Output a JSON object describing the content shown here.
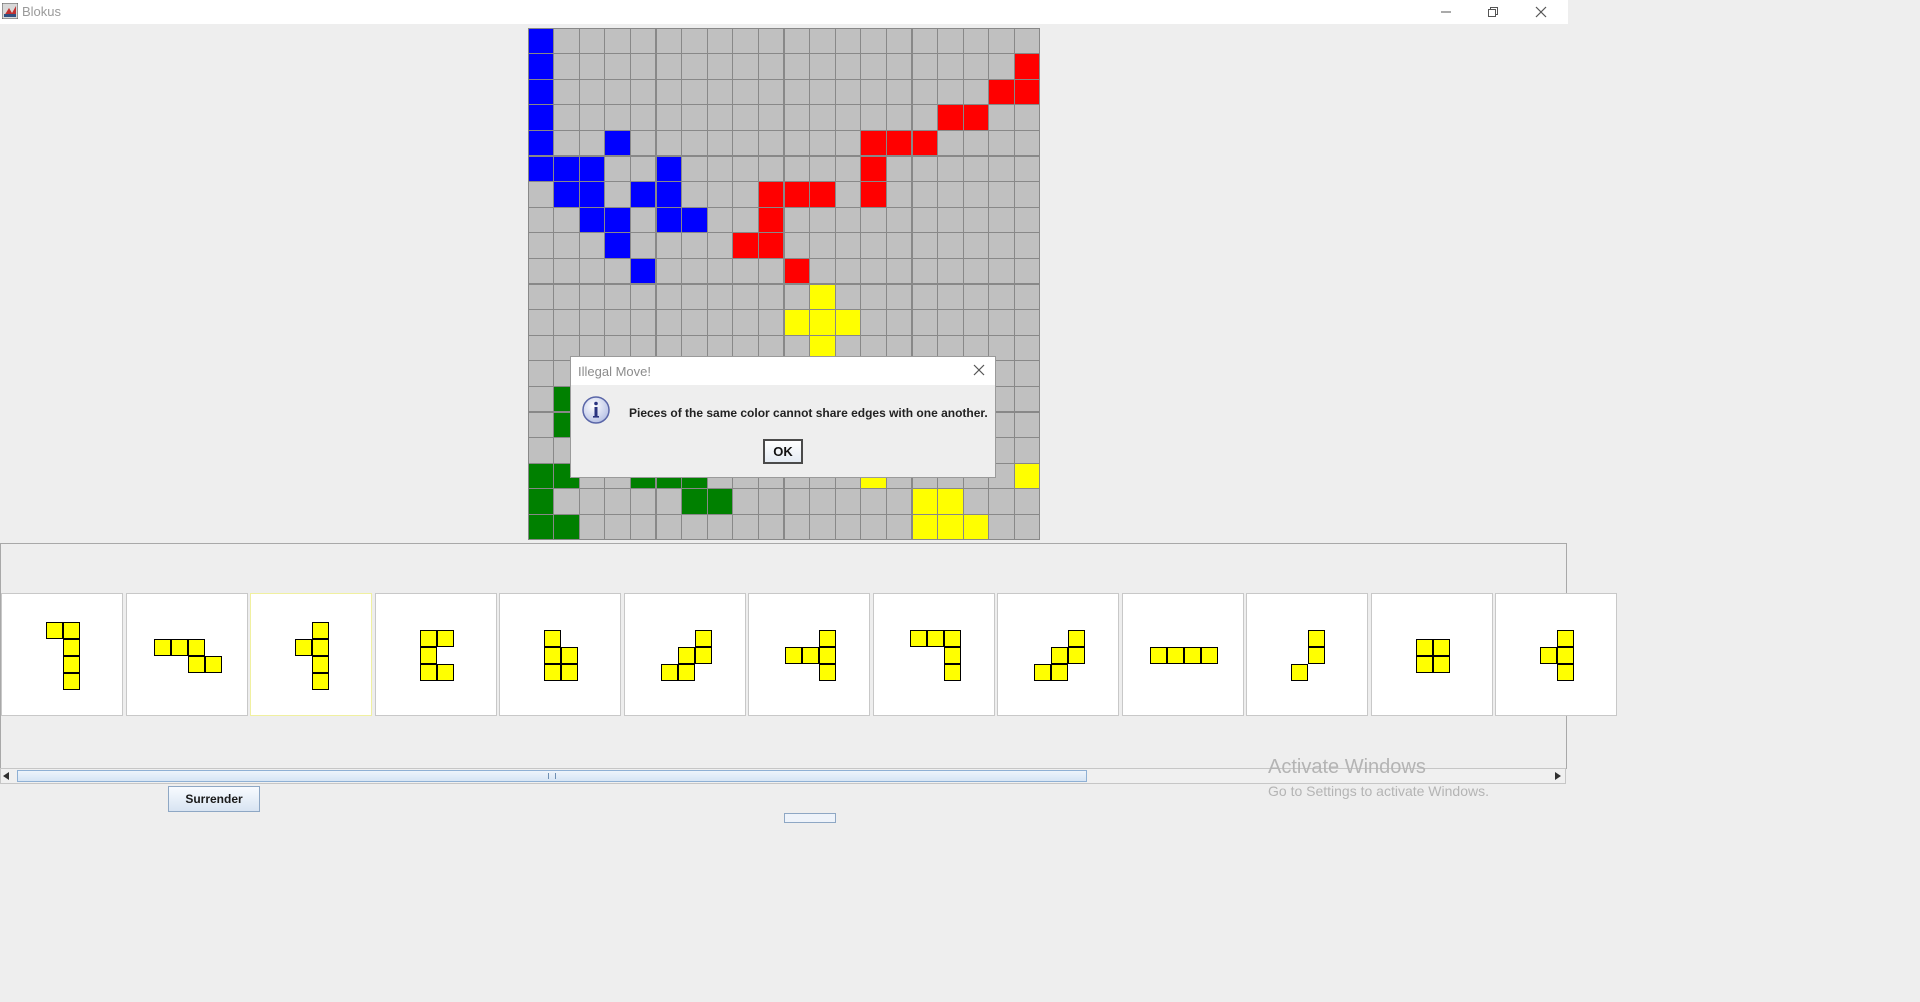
{
  "window": {
    "title": "Blokus",
    "icons": [
      "app-icon",
      "minimize-icon",
      "restore-icon",
      "close-icon"
    ]
  },
  "colors": {
    "B": "#0000ff",
    "R": "#ff0000",
    "Y": "#ffff00",
    "G": "#008000",
    "empty": "#c0c0c0",
    "grid": "#888888"
  },
  "board": {
    "size": 20,
    "rows": [
      "B...................",
      "B..................R",
      "B.................RR",
      "B...............RR..",
      "B..B.........RRR....",
      "BBB..B.......R......",
      ".BB.BB...RRR.R......",
      "..BB.BB..R..........",
      "...B....RR..........",
      "....B.....R........",
      "...........Y........",
      "..........YYY.......",
      "...........Y........",
      "............Y.......",
      ".G..................",
      ".G..................",
      "....................",
      "GG..GGG......Y.....Y",
      "G.....GG.......YY...",
      "GG.............YYY.."
    ]
  },
  "piece_tray": {
    "selected_index": 2,
    "pieces": [
      [
        [
          0,
          0
        ],
        [
          1,
          0
        ],
        [
          1,
          1
        ],
        [
          1,
          2
        ],
        [
          1,
          3
        ]
      ],
      [
        [
          0,
          0
        ],
        [
          1,
          0
        ],
        [
          2,
          0
        ],
        [
          2,
          1
        ],
        [
          3,
          1
        ]
      ],
      [
        [
          1,
          0
        ],
        [
          0,
          1
        ],
        [
          1,
          1
        ],
        [
          1,
          2
        ],
        [
          1,
          3
        ]
      ],
      [
        [
          0,
          0
        ],
        [
          1,
          0
        ],
        [
          0,
          1
        ],
        [
          0,
          2
        ],
        [
          1,
          2
        ]
      ],
      [
        [
          0,
          0
        ],
        [
          0,
          1
        ],
        [
          1,
          1
        ],
        [
          0,
          2
        ],
        [
          1,
          2
        ]
      ],
      [
        [
          2,
          0
        ],
        [
          1,
          1
        ],
        [
          2,
          1
        ],
        [
          0,
          2
        ],
        [
          1,
          2
        ]
      ],
      [
        [
          2,
          0
        ],
        [
          0,
          1
        ],
        [
          1,
          1
        ],
        [
          2,
          1
        ],
        [
          2,
          2
        ]
      ],
      [
        [
          0,
          0
        ],
        [
          1,
          0
        ],
        [
          2,
          0
        ],
        [
          2,
          1
        ],
        [
          2,
          2
        ]
      ],
      [
        [
          2,
          0
        ],
        [
          1,
          1
        ],
        [
          2,
          1
        ],
        [
          0,
          2
        ],
        [
          1,
          2
        ]
      ],
      [
        [
          0,
          0
        ],
        [
          1,
          0
        ],
        [
          2,
          0
        ],
        [
          3,
          0
        ]
      ],
      [
        [
          1,
          0
        ],
        [
          1,
          1
        ],
        [
          0,
          2
        ]
      ],
      [
        [
          0,
          0
        ],
        [
          1,
          0
        ],
        [
          0,
          1
        ],
        [
          1,
          1
        ]
      ],
      [
        [
          1,
          0
        ],
        [
          0,
          1
        ],
        [
          1,
          1
        ],
        [
          1,
          2
        ]
      ]
    ]
  },
  "controls": {
    "surrender_label": "Surrender"
  },
  "dialog": {
    "title": "Illegal Move!",
    "message": "Pieces of the same color cannot share edges with one another.",
    "ok_label": "OK",
    "icon": "info-icon"
  },
  "watermark": {
    "title": "Activate Windows",
    "subtitle": "Go to Settings to activate Windows."
  }
}
